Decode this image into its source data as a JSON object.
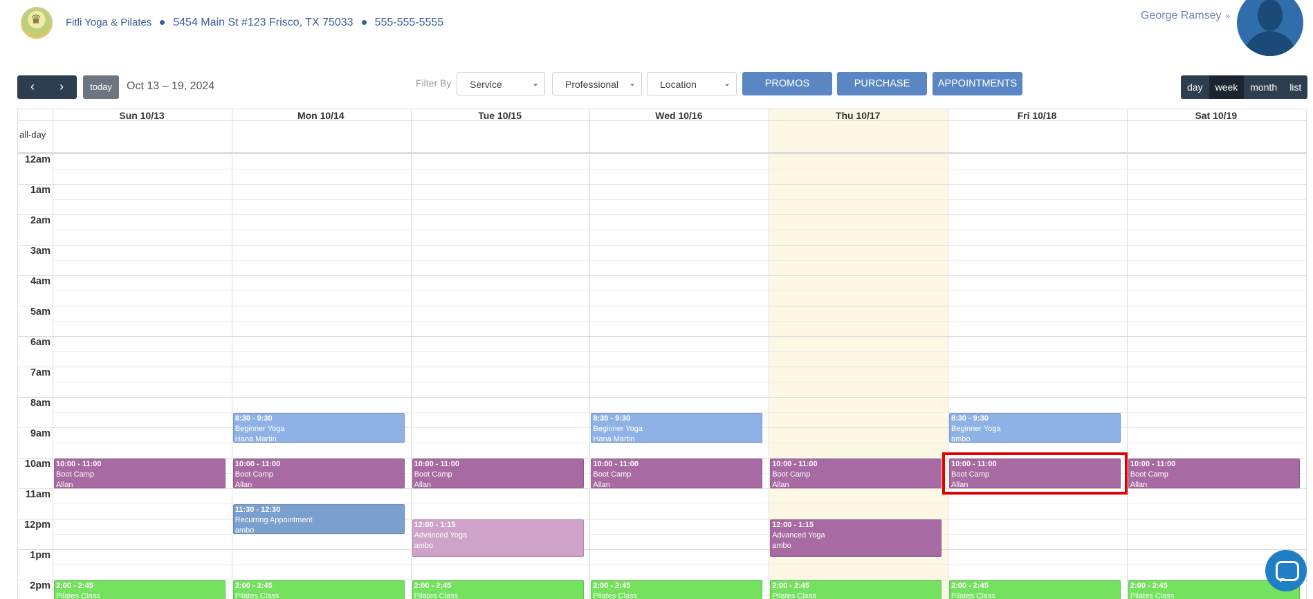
{
  "header": {
    "business_name": "Fitli Yoga & Pilates",
    "address": "5454 Main St #123 Frisco, TX 75033",
    "phone": "555-555-5555",
    "user_name": "George Ramsey",
    "user_chevron": "»"
  },
  "toolbar": {
    "prev_icon": "‹",
    "next_icon": "›",
    "today_label": "today",
    "date_range": "Oct 13 – 19, 2024",
    "filter_label": "Filter By",
    "filters": [
      "Service",
      "Professional",
      "Location"
    ],
    "actions": [
      "PROMOS",
      "PURCHASE",
      "APPOINTMENTS"
    ],
    "views": [
      "day",
      "week",
      "month",
      "list"
    ],
    "active_view": "week"
  },
  "calendar": {
    "allday_label": "all-day",
    "days": [
      "Sun 10/13",
      "Mon 10/14",
      "Tue 10/15",
      "Wed 10/16",
      "Thu 10/17",
      "Fri 10/18",
      "Sat 10/19"
    ],
    "today_index": 4,
    "hours": [
      "12am",
      "1am",
      "2am",
      "3am",
      "4am",
      "5am",
      "6am",
      "7am",
      "8am",
      "9am",
      "10am",
      "11am",
      "12pm",
      "1pm",
      "2pm"
    ],
    "colors": {
      "light_blue": "#8fb2e6",
      "purple": "#a86aa3",
      "steel_blue": "#7b9fcf",
      "faded_purple": "#cfa3c9",
      "green": "#74e25f",
      "today_bg": "#fcf8e3",
      "highlight": "#e00000"
    },
    "events": [
      {
        "day": 1,
        "start": 8.5,
        "end": 9.5,
        "time": "8:30 - 9:30",
        "title": "Beginner Yoga",
        "who": "Hana Martin",
        "color": "light_blue"
      },
      {
        "day": 3,
        "start": 8.5,
        "end": 9.5,
        "time": "8:30 - 9:30",
        "title": "Beginner Yoga",
        "who": "Hana Martin",
        "color": "light_blue"
      },
      {
        "day": 5,
        "start": 8.5,
        "end": 9.5,
        "time": "8:30 - 9:30",
        "title": "Beginner Yoga",
        "who": "ambo",
        "color": "light_blue"
      },
      {
        "day": 0,
        "start": 10,
        "end": 11,
        "time": "10:00 - 11:00",
        "title": "Boot Camp",
        "who": "Allan",
        "color": "purple"
      },
      {
        "day": 1,
        "start": 10,
        "end": 11,
        "time": "10:00 - 11:00",
        "title": "Boot Camp",
        "who": "Allan",
        "color": "purple"
      },
      {
        "day": 2,
        "start": 10,
        "end": 11,
        "time": "10:00 - 11:00",
        "title": "Boot Camp",
        "who": "Allan",
        "color": "purple"
      },
      {
        "day": 3,
        "start": 10,
        "end": 11,
        "time": "10:00 - 11:00",
        "title": "Boot Camp",
        "who": "Allan",
        "color": "purple"
      },
      {
        "day": 4,
        "start": 10,
        "end": 11,
        "time": "10:00 - 11:00",
        "title": "Boot Camp",
        "who": "Allan",
        "color": "purple"
      },
      {
        "day": 5,
        "start": 10,
        "end": 11,
        "time": "10:00 - 11:00",
        "title": "Boot Camp",
        "who": "Allan",
        "color": "purple",
        "highlighted": true
      },
      {
        "day": 6,
        "start": 10,
        "end": 11,
        "time": "10:00 - 11:00",
        "title": "Boot Camp",
        "who": "Allan",
        "color": "purple"
      },
      {
        "day": 1,
        "start": 11.5,
        "end": 12.5,
        "time": "11:30 - 12:30",
        "title": "Recurring Appointment",
        "who": "ambo",
        "color": "steel_blue"
      },
      {
        "day": 2,
        "start": 12,
        "end": 13.25,
        "time": "12:00 - 1:15",
        "title": "Advanced Yoga",
        "who": "ambo",
        "color": "faded_purple"
      },
      {
        "day": 4,
        "start": 12,
        "end": 13.25,
        "time": "12:00 - 1:15",
        "title": "Advanced Yoga",
        "who": "ambo",
        "color": "purple"
      },
      {
        "day": 0,
        "start": 14,
        "end": 14.75,
        "time": "2:00 - 2:45",
        "title": "Pilates Class",
        "who": "",
        "color": "green"
      },
      {
        "day": 1,
        "start": 14,
        "end": 14.75,
        "time": "2:00 - 2:45",
        "title": "Pilates Class",
        "who": "",
        "color": "green"
      },
      {
        "day": 2,
        "start": 14,
        "end": 14.75,
        "time": "2:00 - 2:45",
        "title": "Pilates Class",
        "who": "",
        "color": "green"
      },
      {
        "day": 3,
        "start": 14,
        "end": 14.75,
        "time": "2:00 - 2:45",
        "title": "Pilates Class",
        "who": "",
        "color": "green"
      },
      {
        "day": 4,
        "start": 14,
        "end": 14.75,
        "time": "2:00 - 2:45",
        "title": "Pilates Class",
        "who": "",
        "color": "green"
      },
      {
        "day": 5,
        "start": 14,
        "end": 14.75,
        "time": "2:00 - 2:45",
        "title": "Pilates Class",
        "who": "",
        "color": "green"
      },
      {
        "day": 6,
        "start": 14,
        "end": 14.75,
        "time": "2:00 - 2:45",
        "title": "Pilates Class",
        "who": "",
        "color": "green"
      }
    ]
  },
  "chat": {
    "icon": "chat-bubble-icon"
  }
}
